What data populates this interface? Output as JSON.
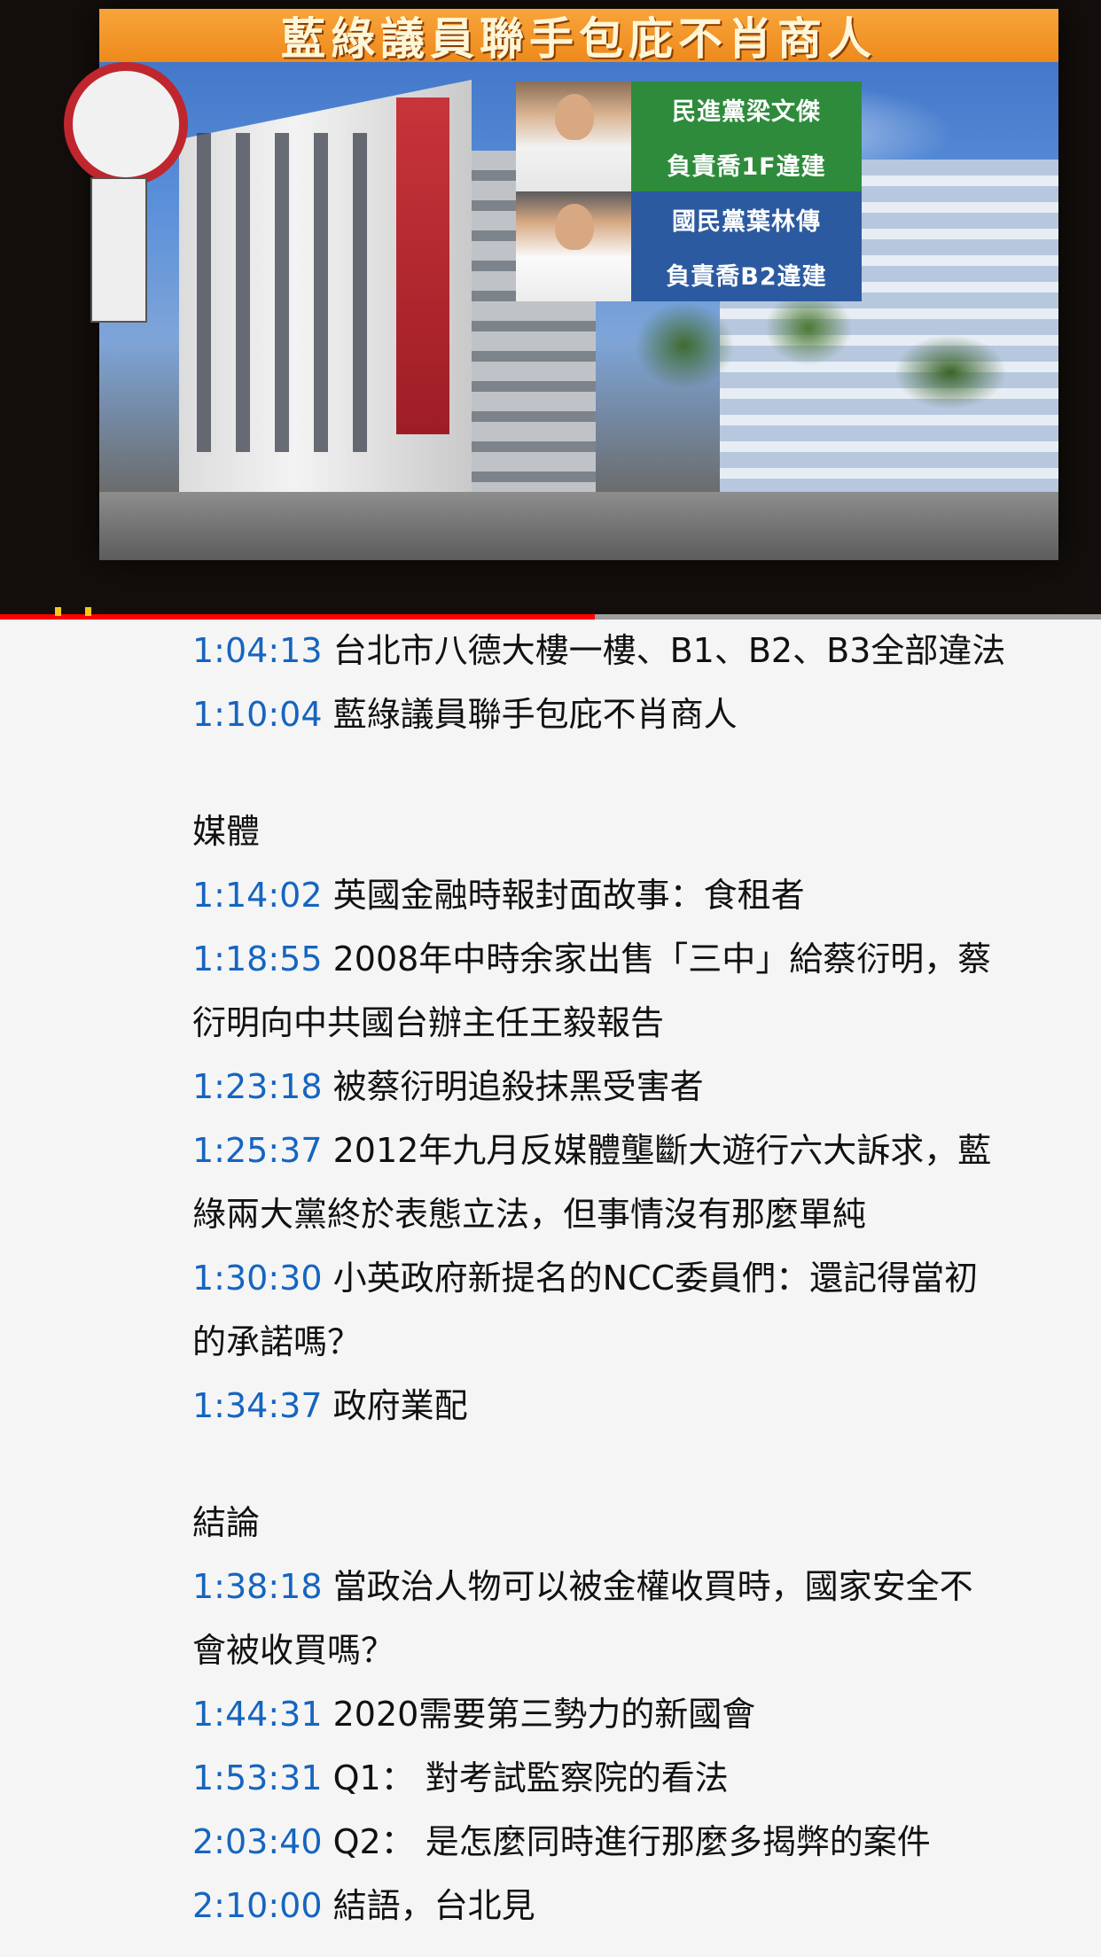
{
  "video": {
    "slide_title": "藍綠議員聯手包庇不肖商人",
    "inset_labels": [
      "民進黨梁文傑",
      "負責喬1F違建",
      "國民黨葉林傳",
      "負責喬B2違建"
    ],
    "progress_fraction": 0.54
  },
  "description": {
    "group_1": [
      {
        "time": "1:04:13",
        "text": "台北市八德大樓一樓、B1、B2、B3全部違法"
      },
      {
        "time": "1:10:04",
        "text": "藍綠議員聯手包庇不肖商人"
      }
    ],
    "section_media": "媒體",
    "group_2": [
      {
        "time": "1:14:02",
        "text": "英國金融時報封面故事：食租者"
      },
      {
        "time": "1:18:55",
        "text": "2008年中時余家出售「三中」給蔡衍明，蔡",
        "cont": "衍明向中共國台辦主任王毅報告"
      },
      {
        "time": "1:23:18",
        "text": "被蔡衍明追殺抹黑受害者"
      },
      {
        "time": "1:25:37",
        "text": "2012年九月反媒體壟斷大遊行六大訴求，藍",
        "cont": "綠兩大黨終於表態立法，但事情沒有那麼單純"
      },
      {
        "time": "1:30:30",
        "text": "小英政府新提名的NCC委員們：還記得當初",
        "cont": "的承諾嗎？"
      },
      {
        "time": "1:34:37",
        "text": "政府業配"
      }
    ],
    "section_conclusion": "結論",
    "group_3": [
      {
        "time": "1:38:18",
        "text": "當政治人物可以被金權收買時，國家安全不",
        "cont": "會被收買嗎？"
      },
      {
        "time": "1:44:31",
        "text": "2020需要第三勢力的新國會"
      },
      {
        "time": "1:53:31",
        "text": "Q1： 對考試監察院的看法"
      },
      {
        "time": "2:03:40",
        "text": "Q2： 是怎麼同時進行那麼多揭弊的案件"
      },
      {
        "time": "2:10:00",
        "text": "結語，台北見"
      }
    ]
  },
  "colors": {
    "timestamp": "#1565c0",
    "text": "#111111",
    "background": "#f5f5f5",
    "progress": "#ff0000"
  }
}
